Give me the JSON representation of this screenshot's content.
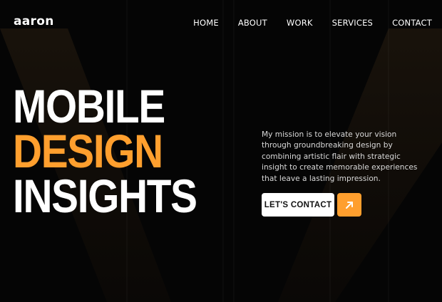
{
  "brand": {
    "logo_text": "aaron"
  },
  "nav": {
    "items": [
      {
        "label": "HOME"
      },
      {
        "label": "ABOUT"
      },
      {
        "label": "WORK"
      },
      {
        "label": "SERVICES"
      },
      {
        "label": "CONTACT"
      }
    ]
  },
  "hero": {
    "line1": "MOBILE",
    "line2": "DESIGN",
    "line3": "INSIGHTS",
    "mission": "My mission is to elevate your vision through groundbreaking design by combining artistic flair with strategic insight to create memorable experiences that leave a lasting impression.",
    "cta_label": "LET'S CONTACT"
  },
  "icons": {
    "cta_arrow": "arrow-up-right-icon"
  },
  "colors": {
    "background": "#050505",
    "accent": "#ff9f2e",
    "text": "#ffffff",
    "muted_text": "#d9d9d9"
  }
}
